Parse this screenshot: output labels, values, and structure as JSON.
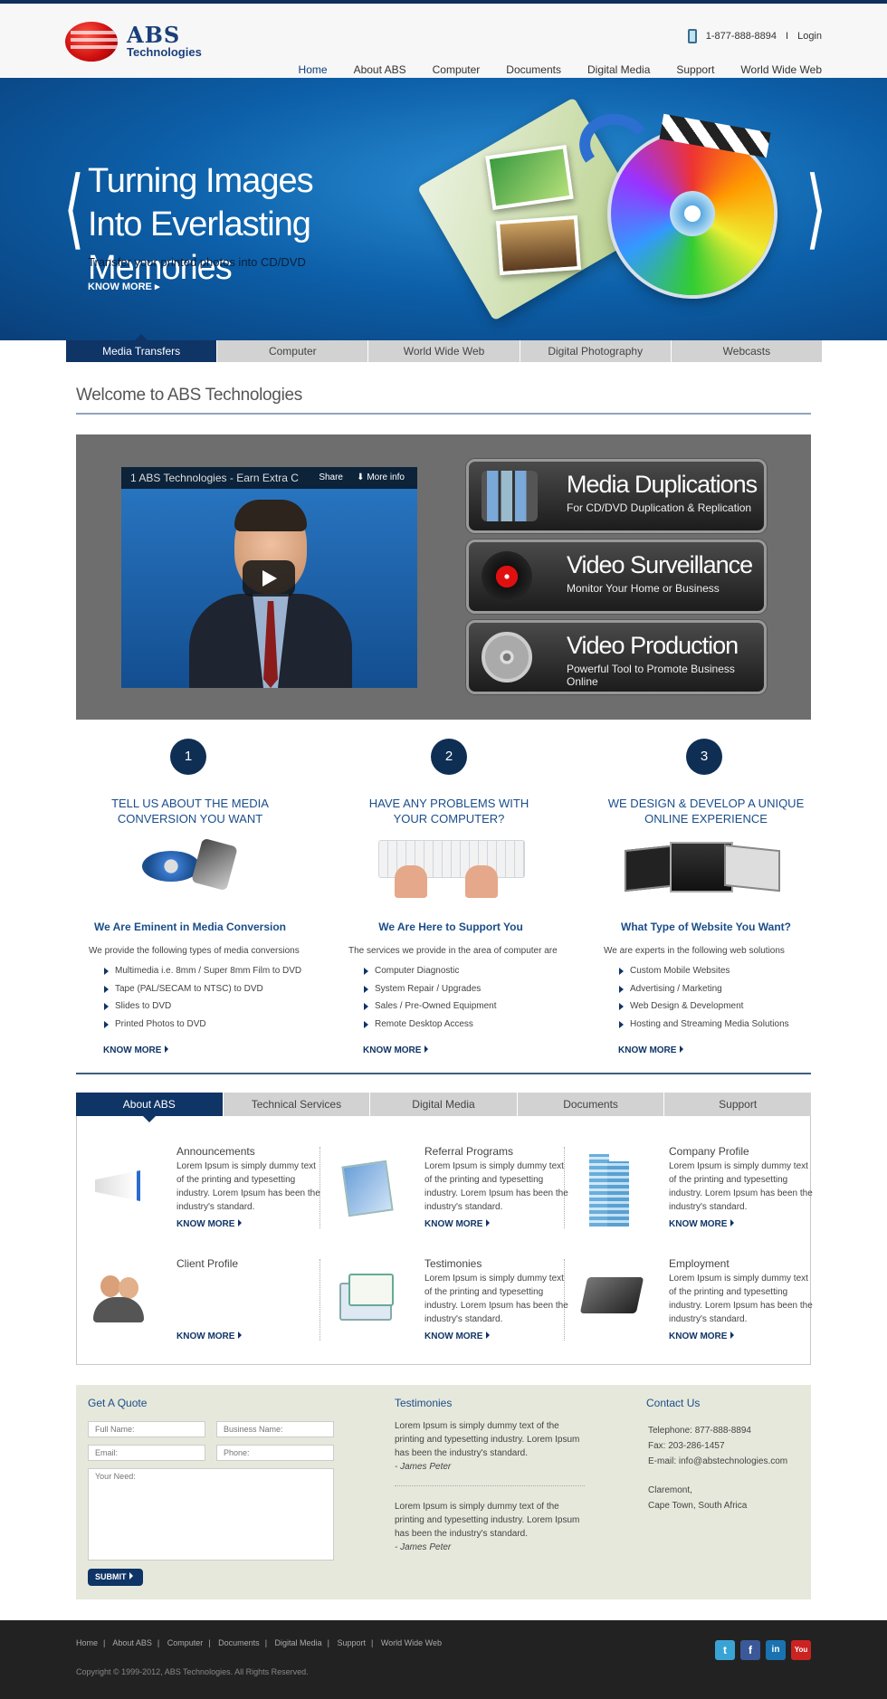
{
  "header": {
    "logo_abs": "ABS",
    "logo_tech": "Technologies",
    "phone": "1-877-888-8894",
    "divider": "I",
    "login": "Login"
  },
  "nav": [
    "Home",
    "About ABS",
    "Computer",
    "Documents",
    "Digital Media",
    "Support",
    "World Wide Web"
  ],
  "hero": {
    "prev_arrow": "⟨",
    "next_arrow": "⟩",
    "title_line1": "Turning Images",
    "title_line2": "Into Everlasting Memories",
    "subtitle": "Transfer your printed photos into CD/DVD",
    "know_more": "KNOW MORE"
  },
  "service_tabs": [
    "Media Transfers",
    "Computer",
    "World Wide Web",
    "Digital Photography",
    "Webcasts"
  ],
  "welcome": "Welcome to ABS Technologies",
  "video": {
    "title": "1 ABS Technologies - Earn Extra C",
    "share": "Share",
    "more": "More info"
  },
  "promos": [
    {
      "title": "Media Duplications",
      "sub": "For CD/DVD Duplication & Replication"
    },
    {
      "title": "Video Surveillance",
      "sub": "Monitor Your Home or Business"
    },
    {
      "title": "Video Production",
      "sub": "Powerful Tool to Promote Business Online"
    }
  ],
  "steps": [
    {
      "num": "1",
      "title1": "TELL US ABOUT THE MEDIA",
      "title2": "CONVERSION YOU WANT",
      "head": "We Are Eminent in Media Conversion",
      "intro": "We provide the following types of media conversions",
      "items": [
        "Multimedia i.e. 8mm / Super 8mm Film to DVD",
        "Tape (PAL/SECAM to NTSC) to DVD",
        "Slides to DVD",
        "Printed Photos to DVD"
      ],
      "know": "KNOW MORE"
    },
    {
      "num": "2",
      "title1": "HAVE ANY PROBLEMS WITH",
      "title2": "YOUR COMPUTER?",
      "head": "We Are Here to Support You",
      "intro": "The services we provide in the area of computer are",
      "items": [
        "Computer Diagnostic",
        "System Repair / Upgrades",
        "Sales / Pre-Owned Equipment",
        "Remote Desktop Access"
      ],
      "know": "KNOW MORE"
    },
    {
      "num": "3",
      "title1": "WE DESIGN & DEVELOP A UNIQUE",
      "title2": "ONLINE EXPERIENCE",
      "head": "What Type of Website You Want?",
      "intro": "We are experts in the following web solutions",
      "items": [
        "Custom Mobile Websites",
        "Advertising / Marketing",
        "Web Design & Development",
        "Hosting and Streaming Media Solutions"
      ],
      "know": "KNOW MORE"
    }
  ],
  "about_tabs": [
    "About ABS",
    "Technical Services",
    "Digital Media",
    "Documents",
    "Support"
  ],
  "cards": [
    {
      "title": "Announcements",
      "text": "Lorem Ipsum is simply dummy text of the printing and typesetting industry. Lorem Ipsum has been the industry's standard.",
      "know": "KNOW MORE"
    },
    {
      "title": "Referral Programs",
      "text": "Lorem Ipsum is simply dummy text of the printing and typesetting industry. Lorem Ipsum has been the industry's standard.",
      "know": "KNOW MORE"
    },
    {
      "title": "Company Profile",
      "text": "Lorem Ipsum is simply dummy text of the printing and typesetting industry. Lorem Ipsum has been the industry's standard.",
      "know": "KNOW MORE"
    },
    {
      "title": "Client Profile",
      "text": "",
      "know": "KNOW MORE"
    },
    {
      "title": "Testimonies",
      "text": "Lorem Ipsum is simply dummy text of the printing and typesetting industry. Lorem Ipsum has been the industry's standard.",
      "know": "KNOW MORE"
    },
    {
      "title": "Employment",
      "text": "Lorem Ipsum is simply dummy text of the printing and typesetting industry. Lorem Ipsum has been the industry's standard.",
      "know": "KNOW MORE"
    }
  ],
  "quote": {
    "heading": "Get A Quote",
    "full_name": "Full Name:",
    "business_name": "Business Name:",
    "email": "Email:",
    "phone": "Phone:",
    "need": "Your Need:",
    "submit": "SUBMIT"
  },
  "testimonies": {
    "heading": "Testimonies",
    "items": [
      {
        "text": "Lorem Ipsum is simply dummy text of the printing and typesetting industry. Lorem Ipsum has been the industry's standard.",
        "author": "- James Peter"
      },
      {
        "text": "Lorem Ipsum is simply dummy text of the printing and typesetting industry. Lorem Ipsum has been the industry's standard.",
        "author": "- James Peter"
      }
    ]
  },
  "contact": {
    "heading": "Contact Us",
    "telephone": "Telephone:   877-888-8894",
    "fax": "Fax:   203-286-1457",
    "email": "E-mail:    info@abstechnologies.com",
    "address1": "Claremont,",
    "address2": "Cape Town,  South Africa"
  },
  "footer": {
    "links": [
      "Home",
      "About ABS",
      "Computer",
      "Documents",
      "Digital Media",
      "Support",
      "World Wide Web"
    ],
    "separator": "|",
    "copyright": "Copyright © 1999-2012, ABS Technologies. All Rights Reserved.",
    "social": [
      "t",
      "f",
      "in",
      "You"
    ]
  },
  "colors": {
    "navy": "#0f3466",
    "accent_blue": "#1a4d8a",
    "hero_blue": "#0c5fa8",
    "panel_gray": "#6e6e6e",
    "quote_bg": "#e6e8dc",
    "footer_bg": "#222222",
    "twitter": "#3aa3d6",
    "facebook": "#3b5998",
    "linkedin": "#1a73b0",
    "youtube": "#cc2222"
  }
}
